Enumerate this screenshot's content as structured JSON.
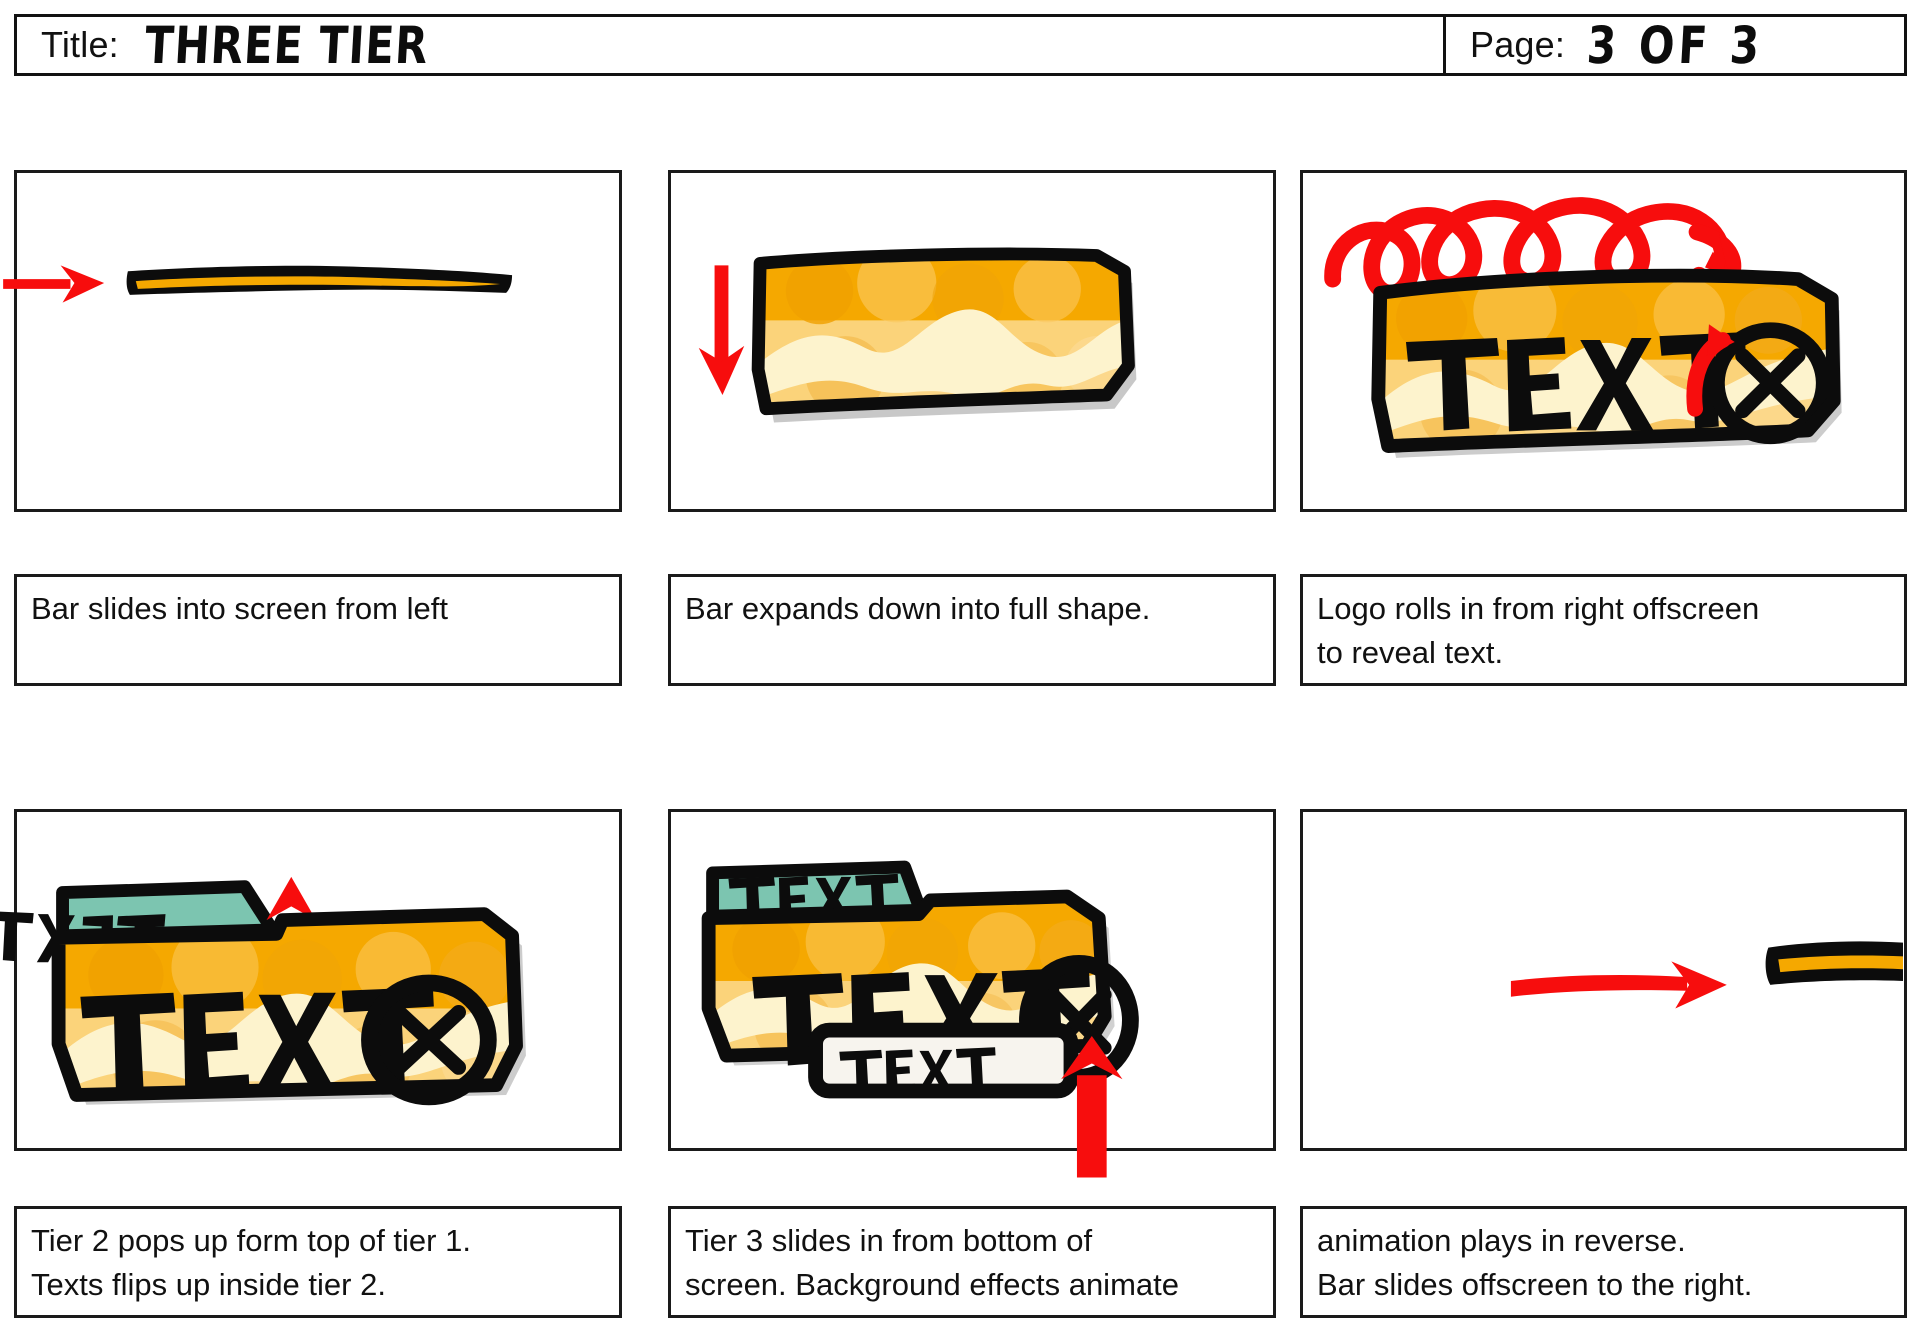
{
  "header": {
    "title_label": "Title:",
    "title_value": "THREE TIER",
    "page_label": "Page:",
    "page_value": "3 OF 3"
  },
  "colors": {
    "ink": "#1a1a1a",
    "arrow_red": "#f70d0d",
    "orange_deep": "#f5a800",
    "orange_mid": "#f9bb33",
    "orange_light": "#fbd37a",
    "cream": "#fdf3cd",
    "teal": "#7cc5b0",
    "offwhite": "#f7f4ee",
    "shadow": "#808080"
  },
  "panels": [
    {
      "id": "panel-1",
      "frame": "1",
      "art_name": "bar-sliding-in-from-left",
      "elements": [
        "thin-black-bar",
        "orange-core-line",
        "red-arrow-right"
      ],
      "bar_text": "",
      "caption": [
        "Bar slides into screen from left"
      ]
    },
    {
      "id": "panel-2",
      "frame": "2",
      "art_name": "bar-expanded-full-shape",
      "elements": [
        "orange-bar",
        "cream-wave",
        "red-arrow-down"
      ],
      "bar_text": "",
      "caption": [
        "Bar expands down into full shape."
      ]
    },
    {
      "id": "panel-3",
      "frame": "3",
      "art_name": "logo-rolls-in-revealing-text",
      "elements": [
        "orange-bar",
        "cream-wave",
        "text-label",
        "circled-x-logo",
        "red-spiral-arrow",
        "red-hook-arrow"
      ],
      "bar_text": "TEXT",
      "caption": [
        "Logo rolls in from right offscreen",
        "to reveal text."
      ]
    },
    {
      "id": "panel-4",
      "frame": "4",
      "art_name": "tier-2-pops-up",
      "elements": [
        "teal-tier",
        "teal-tier-text-flipped",
        "orange-bar",
        "cream-wave",
        "text-label",
        "circled-x-logo",
        "red-arrow-up"
      ],
      "bar_text": "TEXT",
      "tier2_text": "TEXT",
      "caption": [
        "Tier 2 pops up form top of tier 1.",
        "Texts flips up inside tier 2."
      ]
    },
    {
      "id": "panel-5",
      "frame": "5",
      "art_name": "tier-3-slides-in-from-bottom",
      "elements": [
        "teal-tier",
        "teal-tier-text",
        "orange-bar",
        "cream-wave",
        "text-label",
        "circled-x-logo",
        "white-tier-3",
        "tier3-text",
        "red-arrow-up"
      ],
      "bar_text": "TEXT",
      "tier2_text": "TEXT",
      "tier3_text": "TEXT",
      "caption": [
        "Tier 3 slides in from bottom of",
        "screen. Background effects animate"
      ]
    },
    {
      "id": "panel-6",
      "frame": "6",
      "art_name": "bar-slides-offscreen-right",
      "elements": [
        "red-arrow-right",
        "thin-black-bar-exiting",
        "orange-core-line"
      ],
      "bar_text": "",
      "caption": [
        "animation plays in reverse.",
        "Bar slides offscreen to the right."
      ]
    }
  ]
}
